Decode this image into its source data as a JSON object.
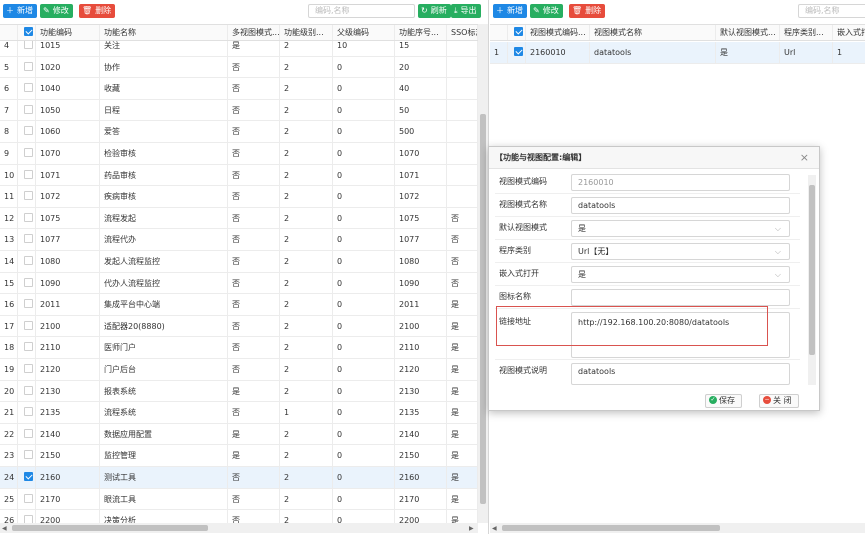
{
  "left_toolbar": {
    "add_label": "新增",
    "edit_label": "修改",
    "delete_label": "删除",
    "search_placeholder": "编码,名称",
    "refresh_label": "刷新",
    "export_label": "导出"
  },
  "left_grid": {
    "columns": [
      "功能编码",
      "功能名称",
      "多视图模式...",
      "功能级别...",
      "父级编码",
      "功能序号...",
      "SSO标志"
    ],
    "rows": [
      {
        "n": "4",
        "code": "1015",
        "name": "关注",
        "multi": "是",
        "level": "2",
        "parent": "10",
        "seq": "15",
        "sso": ""
      },
      {
        "n": "5",
        "code": "1020",
        "name": "协作",
        "multi": "否",
        "level": "2",
        "parent": "0",
        "seq": "20",
        "sso": ""
      },
      {
        "n": "6",
        "code": "1040",
        "name": "收藏",
        "multi": "否",
        "level": "2",
        "parent": "0",
        "seq": "40",
        "sso": ""
      },
      {
        "n": "7",
        "code": "1050",
        "name": "日程",
        "multi": "否",
        "level": "2",
        "parent": "0",
        "seq": "50",
        "sso": ""
      },
      {
        "n": "8",
        "code": "1060",
        "name": "爱答",
        "multi": "否",
        "level": "2",
        "parent": "0",
        "seq": "500",
        "sso": ""
      },
      {
        "n": "9",
        "code": "1070",
        "name": "检验审核",
        "multi": "否",
        "level": "2",
        "parent": "0",
        "seq": "1070",
        "sso": ""
      },
      {
        "n": "10",
        "code": "1071",
        "name": "药品审核",
        "multi": "否",
        "level": "2",
        "parent": "0",
        "seq": "1071",
        "sso": ""
      },
      {
        "n": "11",
        "code": "1072",
        "name": "疾病审核",
        "multi": "否",
        "level": "2",
        "parent": "0",
        "seq": "1072",
        "sso": ""
      },
      {
        "n": "12",
        "code": "1075",
        "name": "流程发起",
        "multi": "否",
        "level": "2",
        "parent": "0",
        "seq": "1075",
        "sso": "否"
      },
      {
        "n": "13",
        "code": "1077",
        "name": "流程代办",
        "multi": "否",
        "level": "2",
        "parent": "0",
        "seq": "1077",
        "sso": "否"
      },
      {
        "n": "14",
        "code": "1080",
        "name": "发起人流程监控",
        "multi": "否",
        "level": "2",
        "parent": "0",
        "seq": "1080",
        "sso": "否"
      },
      {
        "n": "15",
        "code": "1090",
        "name": "代办人流程监控",
        "multi": "否",
        "level": "2",
        "parent": "0",
        "seq": "1090",
        "sso": "否"
      },
      {
        "n": "16",
        "code": "2011",
        "name": "集成平台中心端",
        "multi": "否",
        "level": "2",
        "parent": "0",
        "seq": "2011",
        "sso": "是"
      },
      {
        "n": "17",
        "code": "2100",
        "name": "适配器20(8880)",
        "multi": "否",
        "level": "2",
        "parent": "0",
        "seq": "2100",
        "sso": "是"
      },
      {
        "n": "18",
        "code": "2110",
        "name": "医师门户",
        "multi": "否",
        "level": "2",
        "parent": "0",
        "seq": "2110",
        "sso": "是"
      },
      {
        "n": "19",
        "code": "2120",
        "name": "门户后台",
        "multi": "否",
        "level": "2",
        "parent": "0",
        "seq": "2120",
        "sso": "是"
      },
      {
        "n": "20",
        "code": "2130",
        "name": "报表系统",
        "multi": "是",
        "level": "2",
        "parent": "0",
        "seq": "2130",
        "sso": "是"
      },
      {
        "n": "21",
        "code": "2135",
        "name": "流程系统",
        "multi": "否",
        "level": "1",
        "parent": "0",
        "seq": "2135",
        "sso": "是"
      },
      {
        "n": "22",
        "code": "2140",
        "name": "数据应用配置",
        "multi": "是",
        "level": "2",
        "parent": "0",
        "seq": "2140",
        "sso": "是"
      },
      {
        "n": "23",
        "code": "2150",
        "name": "监控管理",
        "multi": "是",
        "level": "2",
        "parent": "0",
        "seq": "2150",
        "sso": "是"
      },
      {
        "n": "24",
        "code": "2160",
        "name": "测试工具",
        "multi": "否",
        "level": "2",
        "parent": "0",
        "seq": "2160",
        "sso": "是"
      },
      {
        "n": "25",
        "code": "2170",
        "name": "眼流工具",
        "multi": "否",
        "level": "2",
        "parent": "0",
        "seq": "2170",
        "sso": "是"
      },
      {
        "n": "26",
        "code": "2200",
        "name": "决策分析",
        "multi": "否",
        "level": "2",
        "parent": "0",
        "seq": "2200",
        "sso": "是"
      }
    ]
  },
  "right_toolbar": {
    "add_label": "新增",
    "edit_label": "修改",
    "delete_label": "删除",
    "search_placeholder": "编码,名称"
  },
  "right_grid": {
    "columns": [
      "视图模式编码...",
      "视图模式名称",
      "默认视图模式...",
      "程序类别...",
      "嵌入式打..."
    ],
    "rows": [
      {
        "n": "1",
        "code": "2160010",
        "name": "datatools",
        "default": "是",
        "type": "Url",
        "embed": "1"
      }
    ]
  },
  "modal": {
    "title": "【功能与视图配置:编辑】",
    "fields": {
      "code_label": "视图模式编码",
      "code_value": "2160010",
      "name_label": "视图模式名称",
      "name_value": "datatools",
      "default_label": "默认视图模式",
      "default_value": "是",
      "type_label": "程序类别",
      "type_value": "Url【无】",
      "embed_label": "嵌入式打开",
      "embed_value": "是",
      "icon_label": "图标名称",
      "icon_value": "",
      "url_label": "链接地址",
      "url_value": "http://192.168.100.20:8080/datatools",
      "desc_label": "视图模式说明",
      "desc_value": "datatools"
    },
    "save_label": "保存",
    "close_label": "关 闭"
  },
  "colors": {
    "primary": "#1e88e5",
    "success": "#27ae60",
    "danger": "#e74c3c",
    "highlight_border": "#d9534f"
  }
}
